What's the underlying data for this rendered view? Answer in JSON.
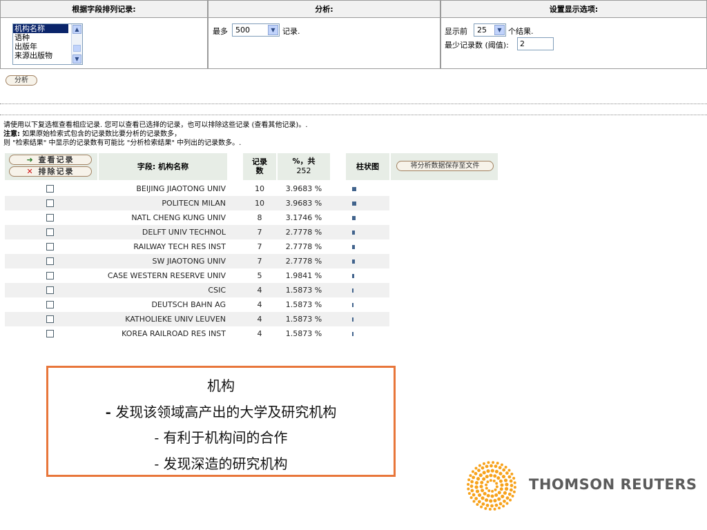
{
  "options": {
    "col1_title": "根据字段排列记录:",
    "col2_title": "分析:",
    "col3_title": "设置显示选项:",
    "fields": [
      "机构名称",
      "语种",
      "出版年",
      "来源出版物"
    ],
    "selected_field": "机构名称",
    "max_prefix": "最多",
    "max_value": "500",
    "max_suffix": "记录.",
    "show_prefix": "显示前",
    "show_value": "25",
    "show_suffix": "个结果.",
    "min_label": "最少记录数 (阈值):",
    "min_value": "2"
  },
  "analyze_button": "分析",
  "info": {
    "line1": "请使用以下复选框查看相应记录. 您可以查看已选择的记录，也可以排除这些记录 (查看其他记录)。.",
    "note_label": "注意:",
    "line2": " 如果原始检索式包含的记录数比要分析的记录数多，",
    "line3": "则 \"检索结果\" 中显示的记录数有可能比 \"分析检索结果\" 中列出的记录数多。."
  },
  "table": {
    "view_button": "查看记录",
    "exclude_button": "排除记录",
    "field_header": "字段: 机构名称",
    "count_header_1": "记录",
    "count_header_2": "数",
    "pct_header_1": "%，共",
    "pct_header_2": "252",
    "bar_header": "柱状图",
    "save_button": "将分析数据保存至文件",
    "rows": [
      {
        "name": "BEIJING JIAOTONG UNIV",
        "count": "10",
        "pct": "3.9683 %",
        "share": 3.9683
      },
      {
        "name": "POLITECN MILAN",
        "count": "10",
        "pct": "3.9683 %",
        "share": 3.9683
      },
      {
        "name": "NATL CHENG KUNG UNIV",
        "count": "8",
        "pct": "3.1746 %",
        "share": 3.1746
      },
      {
        "name": "DELFT UNIV TECHNOL",
        "count": "7",
        "pct": "2.7778 %",
        "share": 2.7778
      },
      {
        "name": "RAILWAY TECH RES INST",
        "count": "7",
        "pct": "2.7778 %",
        "share": 2.7778
      },
      {
        "name": "SW JIAOTONG UNIV",
        "count": "7",
        "pct": "2.7778 %",
        "share": 2.7778
      },
      {
        "name": "CASE WESTERN RESERVE UNIV",
        "count": "5",
        "pct": "1.9841 %",
        "share": 1.9841
      },
      {
        "name": "CSIC",
        "count": "4",
        "pct": "1.5873 %",
        "share": 1.5873
      },
      {
        "name": "DEUTSCH BAHN AG",
        "count": "4",
        "pct": "1.5873 %",
        "share": 1.5873
      },
      {
        "name": "KATHOLIEKE UNIV LEUVEN",
        "count": "4",
        "pct": "1.5873 %",
        "share": 1.5873
      },
      {
        "name": "KOREA RAILROAD RES INST",
        "count": "4",
        "pct": "1.5873 %",
        "share": 1.5873
      }
    ]
  },
  "callout": {
    "title": "机构",
    "line1_dash": "-",
    "line1": " 发现该领域高产出的大学及研究机构",
    "line2": "- 有利于机构间的合作",
    "line3": "- 发现深造的研究机构",
    "border_color": "#e8763a"
  },
  "logo": {
    "text": "THOMSON REUTERS",
    "color": "#f7a21b"
  }
}
